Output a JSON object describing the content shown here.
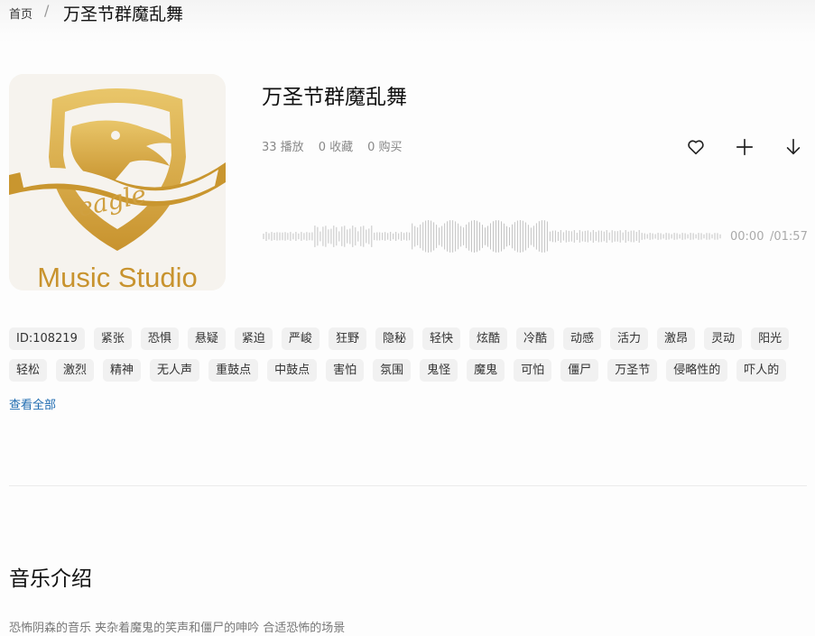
{
  "breadcrumb": {
    "home": "首页",
    "separator": "/",
    "current": "万圣节群魔乱舞"
  },
  "cover": {
    "logo_word": "eagle",
    "studio_name": "Music Studio"
  },
  "track": {
    "title": "万圣节群魔乱舞",
    "plays": "33 播放",
    "favorites": "0 收藏",
    "purchases": "0 购买",
    "current_time": "00:00",
    "duration": "/01:57"
  },
  "actions": {
    "favorite_icon": "heart-icon",
    "add_icon": "plus-icon",
    "download_icon": "arrow-down-icon"
  },
  "tags": [
    "ID:108219",
    "紧张",
    "恐惧",
    "悬疑",
    "紧迫",
    "严峻",
    "狂野",
    "隐秘",
    "轻快",
    "炫酷",
    "冷酷",
    "动感",
    "活力",
    "激昂",
    "灵动",
    "阳光",
    "轻松",
    "激烈",
    "精神",
    "无人声",
    "重鼓点",
    "中鼓点",
    "害怕",
    "氛围",
    "鬼怪",
    "魔鬼",
    "可怕",
    "僵尸",
    "万圣节",
    "侵略性的",
    "吓人的"
  ],
  "view_all": "查看全部",
  "intro": {
    "title": "音乐介绍",
    "text": "恐怖阴森的音乐 夹杂着魔鬼的笑声和僵尸的呻吟 合适恐怖的场景"
  },
  "colors": {
    "accent_link": "#1e6bb0",
    "gold": "#d4a43c",
    "tag_bg": "#f1f1f1"
  }
}
